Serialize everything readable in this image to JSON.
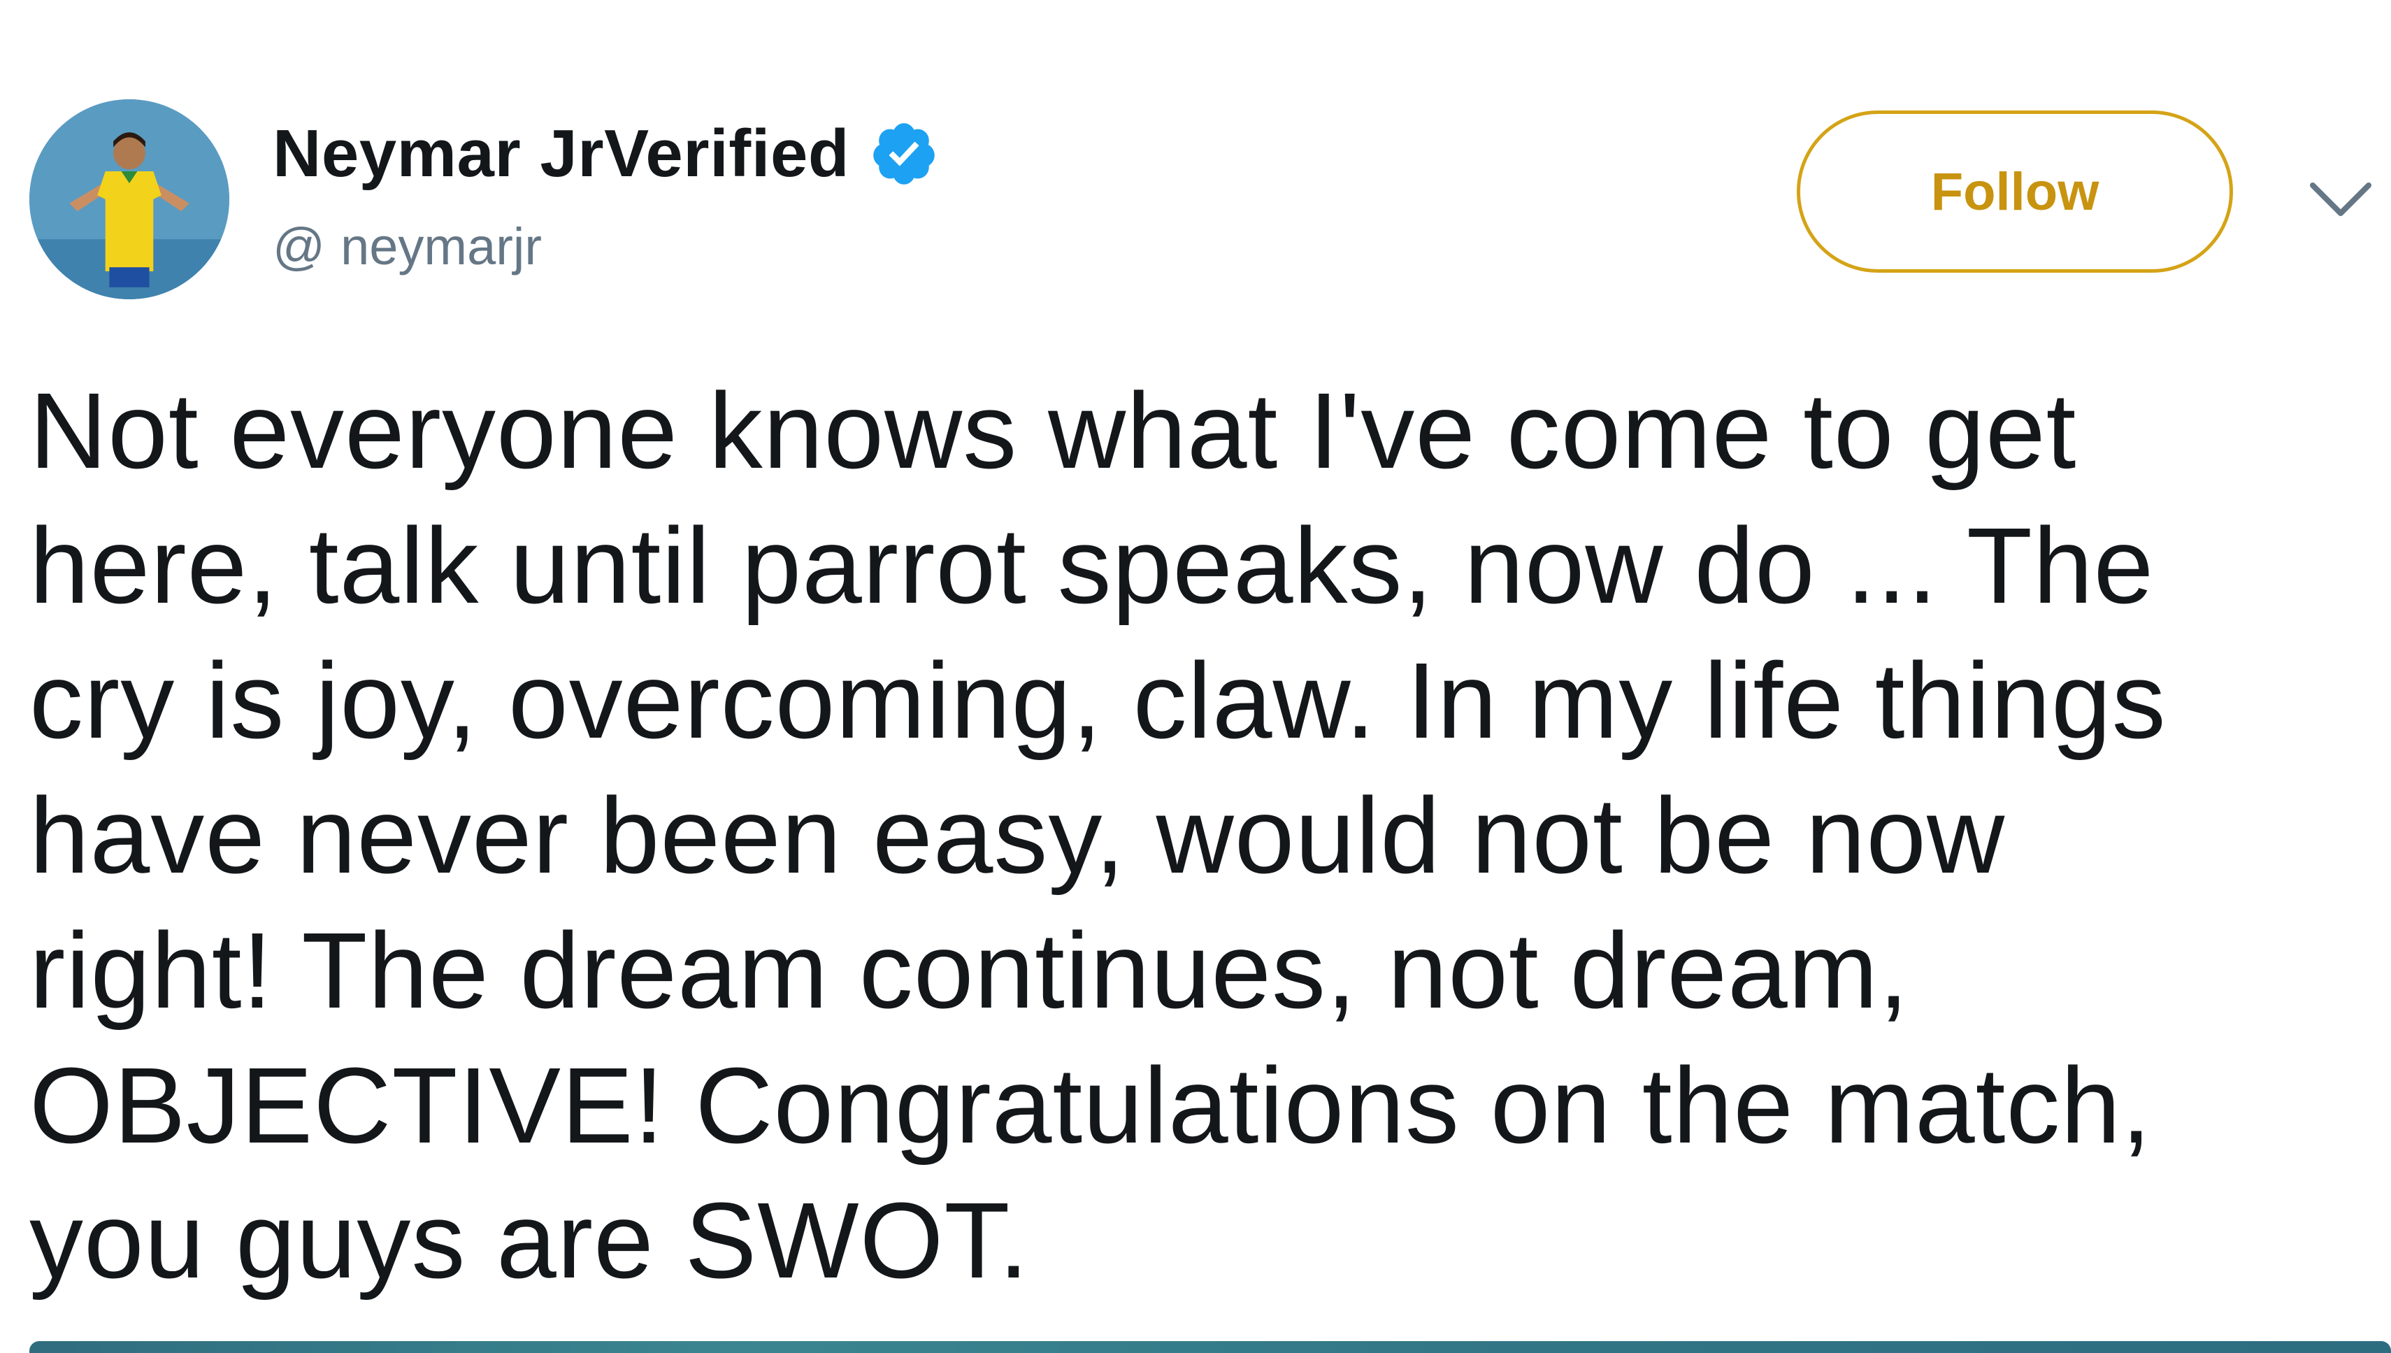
{
  "tweet": {
    "display_name": "Neymar JrVerified",
    "handle_prefix": "@",
    "handle": "neymarjr",
    "follow_label": "Follow",
    "text_lines": [
      "Not everyone knows what I've come to get",
      "here, talk until parrot speaks, now do ... The",
      "cry is joy, overcoming, claw. In my life things",
      "have never been easy, would not be now",
      "right! The dream continues, not dream,",
      "OBJECTIVE! Congratulations on the match,",
      "you guys are SWOT."
    ]
  },
  "icons": {
    "verified": "verified-badge-icon",
    "menu": "chevron-down-icon"
  },
  "colors": {
    "name_text": "#14171a",
    "handle_text": "#657786",
    "verified_blue": "#1da1f2",
    "follow_accent": "#d4a317",
    "follow_text": "#c8930f"
  }
}
